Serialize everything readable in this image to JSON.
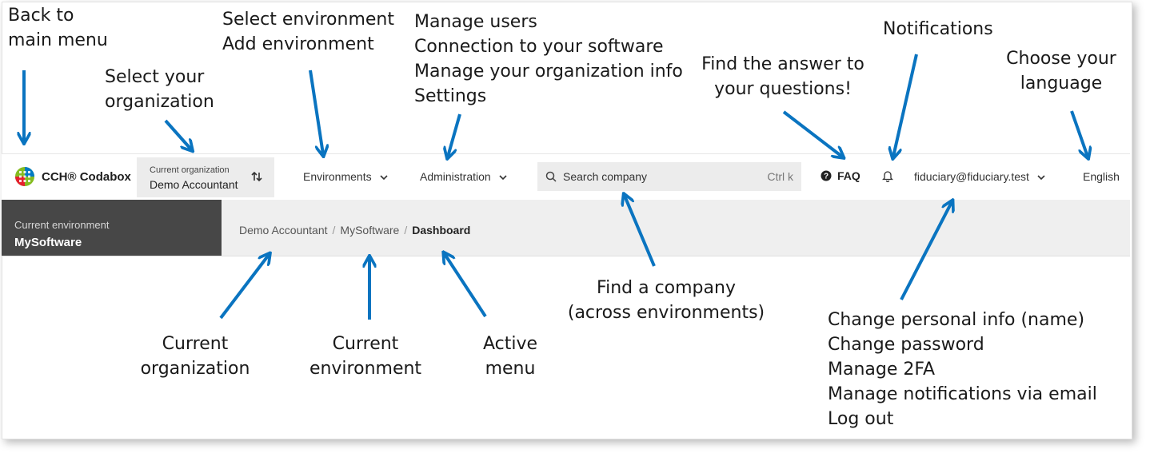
{
  "annotations": {
    "back_to_main_menu": [
      "Back to",
      "main menu"
    ],
    "select_organization": [
      "Select your",
      "organization"
    ],
    "environment": [
      "Select environment",
      "Add environment"
    ],
    "administration": [
      "Manage users",
      "Connection to your software",
      "Manage your organization info",
      "Settings"
    ],
    "faq": [
      "Find the answer to",
      "your questions!"
    ],
    "notifications": [
      "Notifications"
    ],
    "language": [
      "Choose your",
      "language"
    ],
    "find_company": [
      "Find a company",
      "(across environments)"
    ],
    "current_organization": [
      "Current",
      "organization"
    ],
    "current_environment": [
      "Current",
      "environment"
    ],
    "active_menu": [
      "Active",
      "menu"
    ],
    "user_menu": [
      "Change personal info (name)",
      "Change password",
      "Manage 2FA",
      "Manage notifications via email",
      "Log out"
    ]
  },
  "topbar": {
    "brand": "CCH® Codabox",
    "org_caption": "Current organization",
    "org_name": "Demo Accountant",
    "environments_label": "Environments",
    "administration_label": "Administration",
    "search_placeholder": "Search company",
    "search_shortcut": "Ctrl k",
    "faq_label": "FAQ",
    "user_email": "fiduciary@fiduciary.test",
    "language": "English"
  },
  "envbar": {
    "env_caption": "Current environment",
    "env_name": "MySoftware",
    "breadcrumb": [
      "Demo Accountant",
      "MySoftware",
      "Dashboard"
    ]
  },
  "colors": {
    "arrow": "#0a74c0",
    "env_box": "#474747",
    "bar_bg": "#efefef",
    "logo_green": "#85bc20",
    "logo_blue": "#007ac3",
    "logo_red": "#e5202e"
  }
}
